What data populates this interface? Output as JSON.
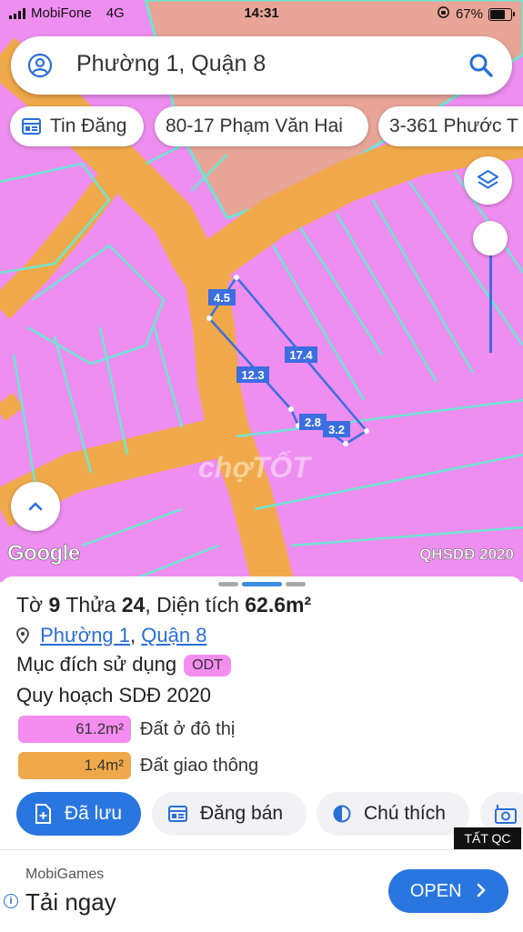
{
  "status_bar": {
    "carrier": "MobiFone",
    "network": "4G",
    "time": "14:31",
    "battery": "67%",
    "battery_level": 0.67
  },
  "search": {
    "text": "Phường 1, Quận 8"
  },
  "chips": [
    {
      "label": "Tin Đăng",
      "icon": "news-icon"
    },
    {
      "label": "80-17 Phạm Văn Hai"
    },
    {
      "label": "3-361 Phước T"
    }
  ],
  "map": {
    "dimensions": {
      "top": "4.5",
      "top_right": "17.4",
      "left": "12.3",
      "bottom_left": "2.8",
      "bottom_right": "3.2"
    },
    "attribution": "Google",
    "layer_label": "QHSDĐ 2020",
    "watermark": "chợTỐT",
    "colors": {
      "residential": "#ee8ef0",
      "road": "#f0a94a",
      "park": "#e8a598",
      "boundary": "#6ee6d2",
      "lot_outline": "#3b6ee0"
    }
  },
  "parcel": {
    "title_prefix": "Tờ",
    "sheet_no": "9",
    "parcel_label": "Thửa",
    "parcel_no": "24",
    "area_label": "Diện tích",
    "area": "62.6m²",
    "ward": "Phường 1",
    "separator": ",",
    "district": "Quận 8",
    "purpose_label": "Mục đích sử dụng",
    "purpose_code": "ODT",
    "plan_label": "Quy hoạch SDĐ 2020",
    "legend": [
      {
        "value": "61.2m²",
        "label": "Đất ở đô thị",
        "color": "#f58cf0"
      },
      {
        "value": "1.4m²",
        "label": "Đất giao thông",
        "color": "#f0a94a"
      }
    ]
  },
  "actions": [
    {
      "label": "Đã lưu",
      "icon": "saved-doc-icon"
    },
    {
      "label": "Đăng bán",
      "icon": "calendar-icon"
    },
    {
      "label": "Chú thích",
      "icon": "half-circle-icon"
    }
  ],
  "ad_badge": "TẤT QC",
  "ad": {
    "brand": "MobiGames",
    "cta": "Tải ngay",
    "button": "OPEN"
  }
}
